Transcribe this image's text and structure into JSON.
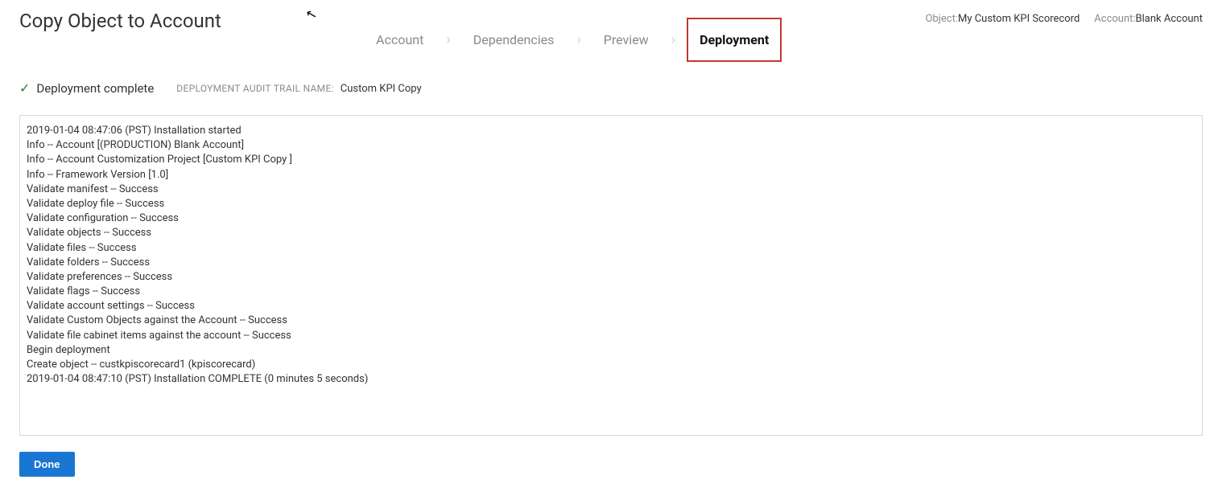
{
  "header": {
    "title": "Copy Object to Account",
    "meta": {
      "object_label": "Object:",
      "object_value": "My Custom KPI Scorecord",
      "account_label": "Account:",
      "account_value": "Blank Account"
    }
  },
  "wizard": {
    "steps": [
      {
        "label": "Account",
        "active": false
      },
      {
        "label": "Dependencies",
        "active": false
      },
      {
        "label": "Preview",
        "active": false
      },
      {
        "label": "Deployment",
        "active": true
      }
    ]
  },
  "status": {
    "text": "Deployment complete",
    "audit_label": "DEPLOYMENT AUDIT TRAIL NAME:",
    "audit_value": "Custom KPI Copy"
  },
  "log_lines": [
    "2019-01-04 08:47:06 (PST) Installation started",
    "Info -- Account [(PRODUCTION) Blank Account]",
    "Info -- Account Customization Project [Custom KPI Copy ]",
    "Info -- Framework Version [1.0]",
    "Validate manifest -- Success",
    "Validate deploy file -- Success",
    "Validate configuration -- Success",
    "Validate objects -- Success",
    "Validate files -- Success",
    "Validate folders -- Success",
    "Validate preferences -- Success",
    "Validate flags -- Success",
    "Validate account settings -- Success",
    "Validate Custom Objects against the Account -- Success",
    "Validate file cabinet items against the account -- Success",
    "Begin deployment",
    "Create object -- custkpiscorecard1 (kpiscorecard)",
    "2019-01-04 08:47:10 (PST) Installation COMPLETE (0 minutes 5 seconds)"
  ],
  "footer": {
    "done_label": "Done"
  }
}
